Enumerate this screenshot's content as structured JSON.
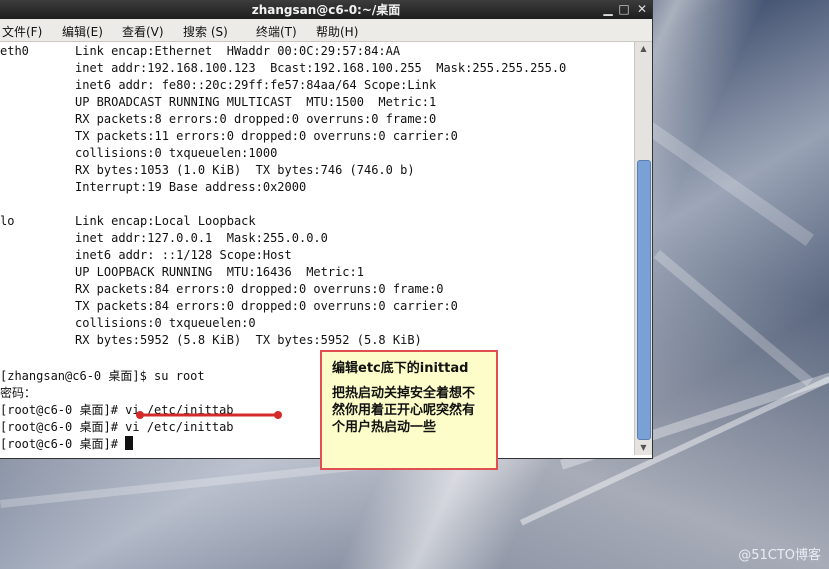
{
  "window": {
    "title": "zhangsan@c6-0:~/桌面"
  },
  "menu": [
    "文件(F)",
    "编辑(E)",
    "查看(V)",
    "搜索 (S)",
    "终端(T)",
    "帮助(H)"
  ],
  "terminal": {
    "lines": [
      {
        "a": "eth0",
        "b": "Link encap:Ethernet  HWaddr 00:0C:29:57:84:AA"
      },
      {
        "a": "",
        "b": "inet addr:192.168.100.123  Bcast:192.168.100.255  Mask:255.255.255.0"
      },
      {
        "a": "",
        "b": "inet6 addr: fe80::20c:29ff:fe57:84aa/64 Scope:Link"
      },
      {
        "a": "",
        "b": "UP BROADCAST RUNNING MULTICAST  MTU:1500  Metric:1"
      },
      {
        "a": "",
        "b": "RX packets:8 errors:0 dropped:0 overruns:0 frame:0"
      },
      {
        "a": "",
        "b": "TX packets:11 errors:0 dropped:0 overruns:0 carrier:0"
      },
      {
        "a": "",
        "b": "collisions:0 txqueuelen:1000"
      },
      {
        "a": "",
        "b": "RX bytes:1053 (1.0 KiB)  TX bytes:746 (746.0 b)"
      },
      {
        "a": "",
        "b": "Interrupt:19 Base address:0x2000"
      },
      {
        "a": "",
        "b": ""
      },
      {
        "a": "lo",
        "b": "Link encap:Local Loopback"
      },
      {
        "a": "",
        "b": "inet addr:127.0.0.1  Mask:255.0.0.0"
      },
      {
        "a": "",
        "b": "inet6 addr: ::1/128 Scope:Host"
      },
      {
        "a": "",
        "b": "UP LOOPBACK RUNNING  MTU:16436  Metric:1"
      },
      {
        "a": "",
        "b": "RX packets:84 errors:0 dropped:0 overruns:0 frame:0"
      },
      {
        "a": "",
        "b": "TX packets:84 errors:0 dropped:0 overruns:0 carrier:0"
      },
      {
        "a": "",
        "b": "collisions:0 txqueuelen:0"
      },
      {
        "a": "",
        "b": "RX bytes:5952 (5.8 KiB)  TX bytes:5952 (5.8 KiB)"
      },
      {
        "a": "",
        "b": ""
      },
      {
        "a": "[zhangsan@c6-0 桌面]$ su root",
        "b": ""
      },
      {
        "a": "密码：",
        "b": ""
      },
      {
        "a": "[root@c6-0 桌面]# vi /etc/inittab",
        "b": ""
      },
      {
        "a": "[root@c6-0 桌面]# vi /etc/inittab",
        "b": ""
      },
      {
        "a": "[root@c6-0 桌面]# ",
        "b": ""
      }
    ]
  },
  "callout": {
    "title": "编辑etc底下的inittad",
    "body": "把热启动关掉安全着想不然你用着正开心呢突然有个用户热启动一些"
  },
  "watermark": "@51CTO博客",
  "colors": {
    "annotation_red": "#d42a2a",
    "callout_bg": "#fdfdc9",
    "scroll_thumb": "#7aa1d6"
  }
}
